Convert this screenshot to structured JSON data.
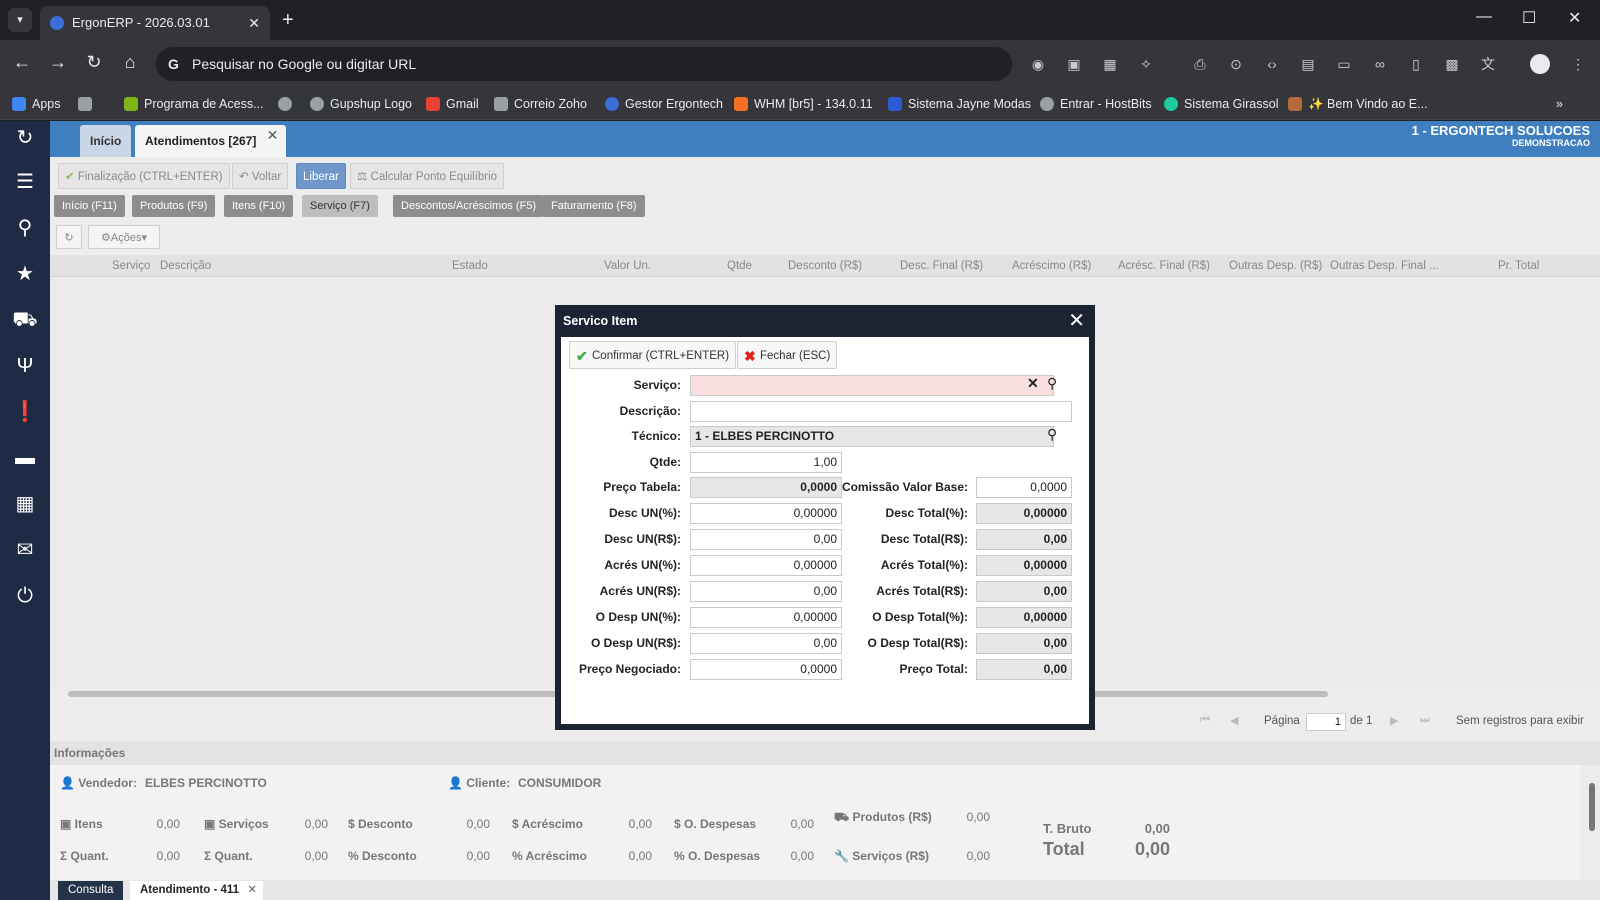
{
  "browser": {
    "tab_title": "ErgonERP - 2026.03.01",
    "address_placeholder": "Pesquisar no Google ou digitar URL",
    "bookmarks": [
      "Apps",
      "Programa de Acess...",
      "Gupshup Logo",
      "Gmail",
      "Correio Zoho",
      "Gestor Ergontech",
      "WHM [br5] - 134.0.11",
      "Sistema Jayne Modas",
      "Entrar - HostBits",
      "Sistema Girassol",
      "✨ Bem Vindo ao E..."
    ]
  },
  "app": {
    "tabs": {
      "home": "Início",
      "active": "Atendimentos [267]"
    },
    "company": {
      "name": "1 - ERGONTECH SOLUCOES",
      "mode": "DEMONSTRACAO"
    },
    "actions": {
      "finalize": "Finalização (CTRL+ENTER)",
      "back": "Voltar",
      "release": "Liberar",
      "equilibrium": "Calcular Ponto Equilíbrio"
    },
    "sections": [
      "Início (F11)",
      "Produtos (F9)",
      "Itens (F10)",
      "Serviço (F7)",
      "Descontos/Acréscimos (F5)",
      "Faturamento (F8)"
    ],
    "grid_actions": "Ações",
    "columns": [
      "Serviço",
      "Descrição",
      "Estado",
      "Valor Un.",
      "Qtde",
      "Desconto (R$)",
      "Desc. Final (R$)",
      "Acréscimo (R$)",
      "Acrésc. Final (R$)",
      "Outras Desp. (R$)",
      "Outras Desp. Final ...",
      "Pr. Total"
    ],
    "pager": {
      "page_label": "Página",
      "page": "1",
      "of_label": "de 1",
      "status": "Sem registros para exibir"
    },
    "info": {
      "title": "Informações",
      "seller_label": "Vendedor:",
      "seller": "ELBES PERCINOTTO",
      "client_label": "Cliente:",
      "client": "CONSUMIDOR",
      "row1": [
        {
          "label": "Itens",
          "value": "0,00"
        },
        {
          "label": "Serviços",
          "value": "0,00"
        },
        {
          "label": "Desconto",
          "value": "0,00"
        },
        {
          "label": "Acréscimo",
          "value": "0,00"
        },
        {
          "label": "O. Despesas",
          "value": "0,00"
        },
        {
          "label": "Produtos (R$)",
          "value": "0,00"
        }
      ],
      "row2": [
        {
          "label": "Quant.",
          "value": "0,00"
        },
        {
          "label": "Quant.",
          "value": "0,00"
        },
        {
          "label": "Desconto",
          "value": "0,00"
        },
        {
          "label": "Acréscimo",
          "value": "0,00"
        },
        {
          "label": "O. Despesas",
          "value": "0,00"
        },
        {
          "label": "Serviços (R$)",
          "value": "0,00"
        }
      ],
      "gross_label": "T. Bruto",
      "gross": "0,00",
      "total_label": "Total",
      "total": "0,00"
    },
    "bottom_tabs": {
      "query": "Consulta",
      "current": "Atendimento - 411"
    }
  },
  "modal": {
    "title": "Servico Item",
    "confirm": "Confirmar (CTRL+ENTER)",
    "close": "Fechar (ESC)",
    "fields": {
      "servico_label": "Serviço:",
      "servico": "",
      "descricao_label": "Descrição:",
      "descricao": "",
      "tecnico_label": "Técnico:",
      "tecnico": "1 - ELBES PERCINOTTO",
      "qtde_label": "Qtde:",
      "qtde": "1,00",
      "preco_tabela_label": "Preço Tabela:",
      "preco_tabela": "0,0000",
      "comissao_label": "Comissão Valor Base:",
      "comissao": "0,0000",
      "desc_un_pct_label": "Desc UN(%):",
      "desc_un_pct": "0,00000",
      "desc_total_pct_label": "Desc Total(%):",
      "desc_total_pct": "0,00000",
      "desc_un_rs_label": "Desc UN(R$):",
      "desc_un_rs": "0,00",
      "desc_total_rs_label": "Desc Total(R$):",
      "desc_total_rs": "0,00",
      "acres_un_pct_label": "Acrés UN(%):",
      "acres_un_pct": "0,00000",
      "acres_total_pct_label": "Acrés Total(%):",
      "acres_total_pct": "0,00000",
      "acres_un_rs_label": "Acrés UN(R$):",
      "acres_un_rs": "0,00",
      "acres_total_rs_label": "Acrés Total(R$):",
      "acres_total_rs": "0,00",
      "odesp_un_pct_label": "O Desp UN(%):",
      "odesp_un_pct": "0,00000",
      "odesp_total_pct_label": "O Desp Total(%):",
      "odesp_total_pct": "0,00000",
      "odesp_un_rs_label": "O Desp UN(R$):",
      "odesp_un_rs": "0,00",
      "odesp_total_rs_label": "O Desp Total(R$):",
      "odesp_total_rs": "0,00",
      "preco_neg_label": "Preço Negociado:",
      "preco_neg": "0,0000",
      "preco_total_label": "Preço Total:",
      "preco_total": "0,00"
    }
  },
  "colors": {
    "app_blue": "#3f7fc0",
    "sidebar": "#1f2a44",
    "modal_dark": "#1c2333",
    "required": "#f9dfe0"
  },
  "icons": [
    "logo-icon",
    "list-icon",
    "search-icon",
    "star-icon",
    "cart-icon",
    "restaurant-icon",
    "alert-icon",
    "chat-icon",
    "calculator-icon",
    "mail-icon",
    "power-icon"
  ]
}
